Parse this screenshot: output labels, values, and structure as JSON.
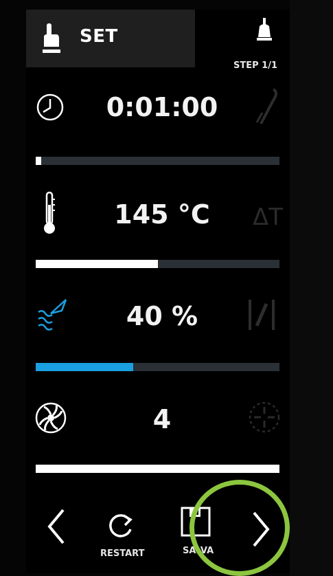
{
  "header": {
    "mode_label": "SET",
    "step_label": "STEP 1/1"
  },
  "rows": {
    "time": {
      "value": "0:01:00",
      "progress": 0.02
    },
    "temperature": {
      "value": "145 °C",
      "progress": 0.5,
      "secondary_label": "ΔT"
    },
    "humidity": {
      "value": "40 %",
      "progress": 0.4
    },
    "fan": {
      "value": "4",
      "progress": 1.0
    }
  },
  "nav": {
    "restart_label": "RESTART",
    "save_label": "SALVA"
  },
  "colors": {
    "accent": "#1a9fe0",
    "highlight": "#8cc63f",
    "track": "#2a3035",
    "fill": "#ffffff"
  },
  "icons": [
    "hand-pointer-icon",
    "bell-icon",
    "clock-icon",
    "probe-icon",
    "thermometer-icon",
    "delta-t-icon",
    "humidity-icon",
    "damper-icon",
    "fan-icon",
    "fan-reverse-icon",
    "chevron-left-icon",
    "restart-icon",
    "save-icon",
    "chevron-right-icon"
  ]
}
